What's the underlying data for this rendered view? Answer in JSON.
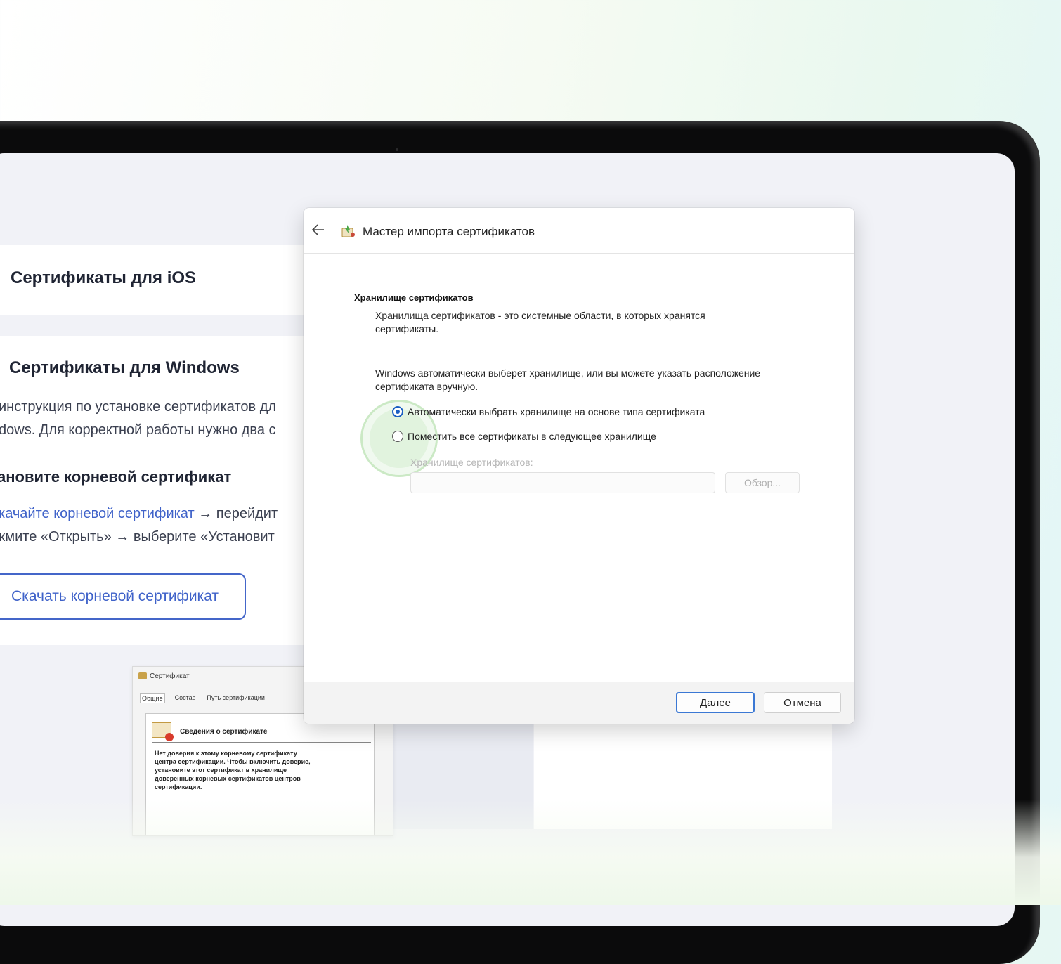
{
  "left_page": {
    "ios_heading": "Сертификаты для iOS",
    "windows_heading": "Сертификаты для Windows",
    "intro_line1": "инструкция по установке сертификатов дл",
    "intro_line2": "dows. Для корректной работы нужно два с",
    "step_heading": "ановите корневой сертификат",
    "step_link": "качайте корневой сертификат",
    "step_line1_rest": " → перейдит",
    "step_line2": "жмите «Открыть» → выберите «Установит",
    "download_button": "Скачать корневой сертификат"
  },
  "cert_window": {
    "title": "Сертификат",
    "tabs": [
      "Общие",
      "Состав",
      "Путь сертификации"
    ],
    "heading": "Сведения о сертификате",
    "text": "Нет доверия к этому корневому сертификату\nцентра сертификации. Чтобы включить доверие,\nустановите этот сертификат в хранилище\nдоверенных корневых сертификатов центров\nсертификации."
  },
  "dialog": {
    "title": "Мастер импорта сертификатов",
    "section_heading": "Хранилище сертификатов",
    "section_desc": "Хранилища сертификатов - это системные области, в которых хранятся сертификаты.",
    "intro": "Windows автоматически выберет хранилище, или вы можете указать расположение сертификата вручную.",
    "option_auto": "Автоматически выбрать хранилище на основе типа сертификата",
    "option_manual": "Поместить все сертификаты в следующее хранилище",
    "store_label": "Хранилище сертификатов:",
    "store_value": "",
    "browse_button": "Обзор...",
    "next_button": "Далее",
    "cancel_button": "Отмена",
    "selected_option": "auto"
  },
  "icons": {
    "back": "arrow-left-icon",
    "wizard": "certificate-wizard-icon",
    "certificate": "certificate-warning-icon"
  },
  "colors": {
    "accent": "#3f62c9",
    "radio": "#1b5ec2",
    "primary_button_border": "#3b78d4",
    "frame": "#0b0b0c"
  }
}
